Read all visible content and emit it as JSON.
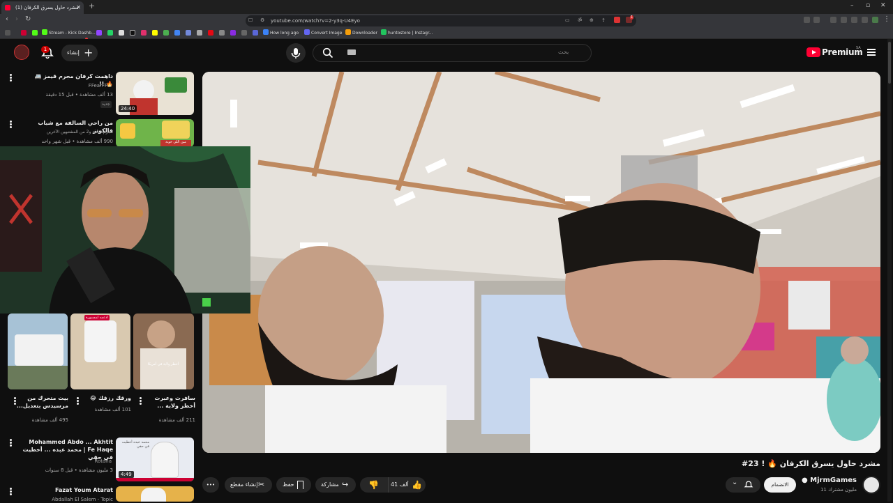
{
  "browser": {
    "tab_title": "(1) مشرد حاول يسرق الكرفان",
    "tab_close": "✕",
    "new_tab": "+",
    "url": "youtube.com/watch?v=2-y3q-U4Eyo",
    "window_controls": [
      "–",
      "▫",
      "✕"
    ],
    "nav": [
      "‹",
      "›",
      "↻"
    ],
    "bookmarks": [
      "Stream - Kick Dashb...",
      "How long ago",
      "Convert Image",
      "Downloader",
      "huntostore | Instagr..."
    ],
    "extension_badge": "1"
  },
  "header": {
    "search_placeholder": "بحث",
    "create_label": "إنشاء",
    "notification_count": "1",
    "logo_text": "Premium",
    "region": "SA"
  },
  "video": {
    "title": "مشرد حاول يسرق الكرفان 🔥 ! 23#",
    "channel_name": "MjrmGames",
    "channel_subs": "11 مليون مشترك",
    "join_label": "الانضمام",
    "likes": "41 ألف",
    "share_label": "مشاركة",
    "save_label": "حفظ",
    "clip_label": "إنشاء مقطع",
    "more": "•••"
  },
  "sidebar": {
    "items": [
      {
        "title": "داهمت كرفان مجرم قيمز 🚐 🔥 !!",
        "channel": "FFearFFul",
        "meta": "13 ألف مشاهدة • قبل 15 دقيقة",
        "badge": "جديد",
        "duration": "24:40"
      },
      {
        "title": "من راحي السالفة مع شباب فالكونز",
        "channel": "مجرم ثمانية و2 من المشتبهين الآخرين",
        "meta": "990 ألف مشاهدة • قبل شهر واحد",
        "thumb_text": "مين اللي خونة"
      },
      {
        "title": "بيت متحرك من مرسيدس بتعديل...",
        "meta": "495 ألف مشاهدة"
      },
      {
        "title": "ورقك رزقك 😂",
        "meta": "101 ألف مشاهدة",
        "badge": "ادعمه لمسبورة"
      },
      {
        "title": "سافرت وعبرت أخطر ولاية ...",
        "meta": "211 ألف مشاهدة",
        "thumb_text": "أخطر ولاية في أمريكا"
      },
      {
        "title": "Mohammed Abdo ... Akhtit Fe Haqe | محمد عبده ... أخطيت في حقي",
        "channel": "Rotana",
        "meta": "3 مليون مشاهدة • قبل 8 سنوات",
        "duration": "4:49",
        "thumb_text": "محمد عبده أخطيت في حقي"
      },
      {
        "title": "Fazat Youm Atarat",
        "channel": "Abdallah El Salem - Topic"
      }
    ]
  },
  "colors": {
    "brand_red": "#ff0033",
    "background": "#0f0f0f",
    "pill": "#272727"
  }
}
